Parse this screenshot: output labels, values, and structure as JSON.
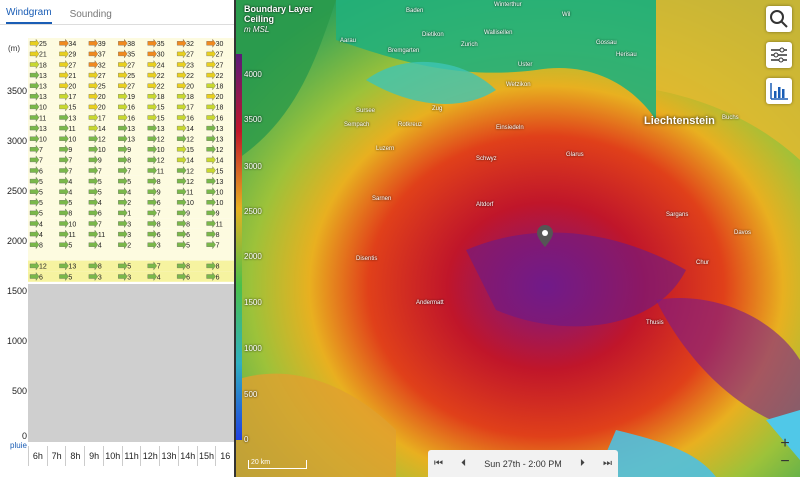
{
  "left_panel": {
    "tabs": [
      {
        "label": "Windgram",
        "active": true
      },
      {
        "label": "Sounding",
        "active": false
      }
    ],
    "unit": "(m)",
    "y_labels": [
      "3500",
      "3000",
      "2500",
      "2000",
      "1500",
      "1000",
      "500",
      "0"
    ],
    "rain_label": "pluie",
    "hours": [
      "6h",
      "7h",
      "8h",
      "9h",
      "10h",
      "11h",
      "12h",
      "13h",
      "14h",
      "15h",
      "16"
    ],
    "rows": [
      [
        "25",
        "34",
        "39",
        "38",
        "35",
        "32",
        "30"
      ],
      [
        "21",
        "29",
        "37",
        "35",
        "30",
        "27",
        "27"
      ],
      [
        "18",
        "27",
        "32",
        "27",
        "24",
        "23",
        "27"
      ],
      [
        "13",
        "21",
        "27",
        "25",
        "22",
        "22",
        "22"
      ],
      [
        "13",
        "20",
        "25",
        "27",
        "22",
        "20",
        "18"
      ],
      [
        "13",
        "17",
        "20",
        "19",
        "18",
        "18",
        "20"
      ],
      [
        "10",
        "15",
        "20",
        "16",
        "15",
        "17",
        "18"
      ],
      [
        "11",
        "13",
        "17",
        "16",
        "15",
        "16",
        "16"
      ],
      [
        "13",
        "11",
        "14",
        "13",
        "13",
        "14",
        "13"
      ],
      [
        "10",
        "10",
        "12",
        "13",
        "12",
        "12",
        "13"
      ],
      [
        "7",
        "9",
        "10",
        "9",
        "10",
        "15",
        "12"
      ],
      [
        "7",
        "7",
        "9",
        "8",
        "12",
        "14",
        "14"
      ],
      [
        "6",
        "7",
        "7",
        "7",
        "11",
        "12",
        "15"
      ],
      [
        "5",
        "4",
        "5",
        "5",
        "8",
        "12",
        "13"
      ],
      [
        "5",
        "4",
        "5",
        "4",
        "9",
        "11",
        "10"
      ],
      [
        "5",
        "5",
        "4",
        "2",
        "6",
        "10",
        "10"
      ],
      [
        "5",
        "8",
        "6",
        "1",
        "7",
        "9",
        "9"
      ],
      [
        "4",
        "10",
        "7",
        "3",
        "8",
        "8",
        "11"
      ],
      [
        "4",
        "11",
        "11",
        "3",
        "6",
        "6",
        "8"
      ],
      [
        "8",
        "5",
        "4",
        "2",
        "3",
        "5",
        "7"
      ],
      [
        "",
        "",
        "",
        "",
        "",
        "",
        ""
      ],
      [
        "12",
        "13",
        "8",
        "5",
        "7",
        "8",
        "8"
      ],
      [
        "6",
        "5",
        "3",
        "3",
        "4",
        "6",
        "6"
      ]
    ]
  },
  "map": {
    "legend_title": "Boundary Layer Ceiling",
    "legend_unit": "m MSL",
    "colorbar_labels": [
      "4000",
      "3500",
      "3000",
      "2500",
      "2000",
      "1500",
      "1000",
      "500",
      "0"
    ],
    "region_label": "Liechtenstein",
    "places": [
      "Baden",
      "Winterthur",
      "Wil",
      "Aarau",
      "Bremgarten",
      "Dietikon",
      "Zurich",
      "Wallisellen",
      "Uster",
      "Wetzikon",
      "Gossau",
      "Herisau",
      "Sursee",
      "Sempach",
      "Zug",
      "Rotkreuz",
      "Einsiedeln",
      "Luzern",
      "Schwyz",
      "Glarus",
      "Sarnen",
      "Altdorf",
      "Davos",
      "Buchs",
      "Sargans",
      "Chur",
      "Thusis",
      "Andermatt",
      "Disentis"
    ],
    "scale_label": "20 km",
    "time_label": "Sun 27th - 2:00 PM",
    "buttons": [
      "search-icon",
      "sliders-icon",
      "chart-icon"
    ],
    "zoom_in": "+",
    "zoom_out": "−"
  }
}
